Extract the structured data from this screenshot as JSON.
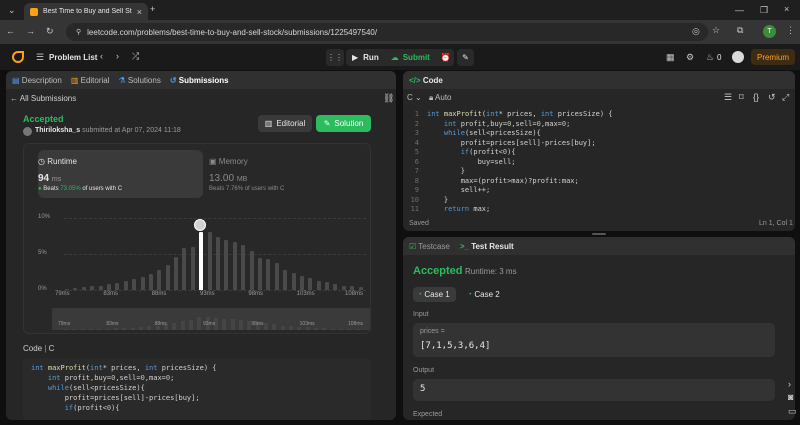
{
  "browser": {
    "tab_title": "Best Time to Buy and Sell Stock",
    "url": "leetcode.com/problems/best-time-to-buy-and-sell-stock/submissions/1225497540/",
    "profile_initial": "T"
  },
  "header": {
    "problem_list": "Problem List",
    "run_label": "Run",
    "submit_label": "Submit",
    "streak_count": "0",
    "premium_label": "Premium"
  },
  "left_tabs": [
    "Description",
    "Editorial",
    "Solutions",
    "Submissions"
  ],
  "all_submissions": "All Submissions",
  "result": {
    "status": "Accepted",
    "user": "Thiriloksha_s",
    "submitted_text": "submitted at Apr 07, 2024 11:18",
    "editorial_btn": "Editorial",
    "solution_btn": "Solution"
  },
  "runtime": {
    "label": "Runtime",
    "value": "94",
    "unit": "ms",
    "beats_prefix": "Beats",
    "beats_pct": "73.05%",
    "beats_suffix": "of users with C"
  },
  "memory": {
    "label": "Memory",
    "value": "13.00",
    "unit": "MB",
    "beats_text": "Beats 7.76% of users with C"
  },
  "chart_data": {
    "type": "bar",
    "y_ticks": [
      "10%",
      "5%",
      "0%"
    ],
    "x_ticks": [
      "79ms",
      "83ms",
      "88ms",
      "93ms",
      "98ms",
      "103ms",
      "108ms"
    ],
    "ylim": [
      0,
      10
    ],
    "values": [
      0.2,
      0.3,
      0.4,
      0.5,
      0.6,
      0.8,
      1.0,
      1.3,
      1.5,
      1.8,
      2.2,
      2.8,
      3.5,
      4.6,
      5.9,
      6.0,
      8.0,
      8.1,
      7.3,
      6.9,
      6.7,
      6.3,
      5.4,
      4.5,
      4.3,
      3.8,
      2.8,
      2.4,
      1.9,
      1.6,
      1.3,
      1.1,
      0.8,
      0.6,
      0.5,
      0.4
    ],
    "highlight_index": 16,
    "minimap_x_ticks": [
      "79ms",
      "83ms",
      "88ms",
      "93ms",
      "98ms",
      "103ms",
      "108ms"
    ]
  },
  "code_section": {
    "label": "Code",
    "lang": "C",
    "lines": [
      "int maxProfit(int* prices, int pricesSize) {",
      "    int profit,buy=0,sell=0,max=0;",
      "    while(sell<pricesSize){",
      "        profit=prices[sell]-prices[buy];",
      "        if(profit<0){"
    ]
  },
  "editor": {
    "title": "Code",
    "lang": "C",
    "mode": "Auto",
    "lines": [
      "int maxProfit(int* prices, int pricesSize) {",
      "    int profit,buy=0,sell=0,max=0;",
      "    while(sell<pricesSize){",
      "        profit=prices[sell]-prices[buy];",
      "        if(profit<0){",
      "            buy=sell;",
      "        }",
      "        max=(profit>max)?profit:max;",
      "        sell++;",
      "    }",
      "    return max;"
    ],
    "line_numbers": [
      "1",
      "2",
      "3",
      "4",
      "5",
      "6",
      "7",
      "8",
      "9",
      "10",
      "11"
    ],
    "saved": "Saved",
    "cursor": "Ln 1, Col 1"
  },
  "test": {
    "tab_testcase": "Testcase",
    "tab_result": "Test Result",
    "status": "Accepted",
    "runtime": "Runtime: 3 ms",
    "case1": "Case 1",
    "case2": "Case 2",
    "input_label": "Input",
    "param_name": "prices =",
    "param_value": "[7,1,5,3,6,4]",
    "output_label": "Output",
    "output_value": "5",
    "expected_label": "Expected"
  },
  "colors": {
    "accent": "#ffa116",
    "success": "#2cbb5d",
    "panel": "#262626"
  }
}
